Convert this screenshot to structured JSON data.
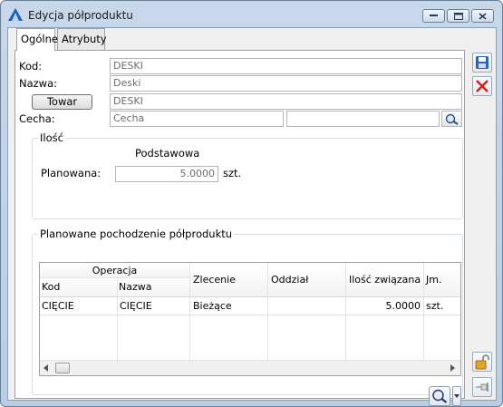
{
  "window": {
    "title": "Edycja półproduktu"
  },
  "tabs": [
    {
      "label": "Ogólne"
    },
    {
      "label": "Atrybuty"
    }
  ],
  "form": {
    "kod_label": "Kod:",
    "kod_value": "DESKI",
    "nazwa_label": "Nazwa:",
    "nazwa_value": "Deski",
    "towar_button": "Towar",
    "towar_value": "DESKI",
    "cecha_label": "Cecha:",
    "cecha_value": "Cecha",
    "cecha2_value": ""
  },
  "ilosc": {
    "group_title": "Ilość",
    "column_header": "Podstawowa",
    "planowana_label": "Planowana:",
    "planowana_value": "5.0000",
    "unit": "szt."
  },
  "pochodzenie": {
    "group_title": "Planowane pochodzenie półproduktu",
    "group_header": "Operacja",
    "columns": [
      "Kod",
      "Nazwa",
      "Zlecenie",
      "Oddział",
      "Ilość związana",
      "Jm."
    ],
    "rows": [
      [
        "CIĘCIE",
        "CIĘCIE",
        "Bieżące",
        "",
        "5.0000",
        "szt."
      ]
    ]
  },
  "colors": {
    "save": "#2a62b8",
    "cancel": "#d42020",
    "accent": "#1f6fc0"
  }
}
